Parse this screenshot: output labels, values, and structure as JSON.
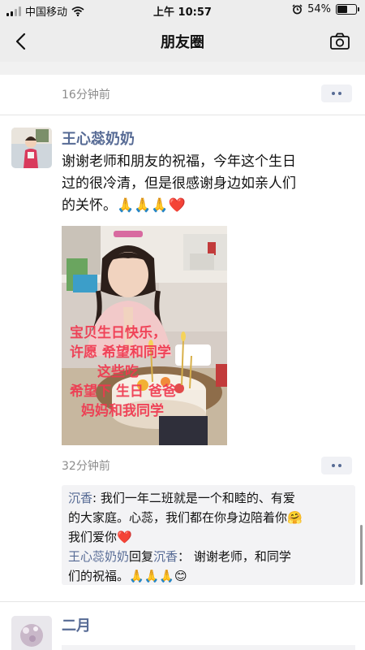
{
  "status_bar": {
    "carrier": "中国移动",
    "time": "上午 10:57",
    "battery_text": "54%",
    "battery_level": 0.54,
    "icons": [
      "signal-icon",
      "wifi-icon",
      "alarm-icon",
      "battery-icon"
    ]
  },
  "nav": {
    "title": "朋友圈",
    "back_icon": "chevron-left-icon",
    "camera_icon": "camera-icon"
  },
  "top_post": {
    "time": "16分钟前"
  },
  "post": {
    "author": "王心蕊奶奶",
    "text_lines": [
      "谢谢老师和朋友的祝福，今年这个生日",
      "过的很冷清，但是很感谢身边如亲人们",
      "的关怀。🙏🙏🙏❤️"
    ],
    "photo_caption": [
      "宝贝生日快乐，",
      "许愿 希望和同学",
      "这些吃",
      "希望下 生日 爸爸",
      "妈妈和我同学"
    ],
    "time": "32分钟前",
    "comments": [
      {
        "name": "沉香",
        "sep": ": ",
        "line1": "我们一年二班就是一个和睦的、有爱",
        "line2": "的大家庭。心蕊，我们都在你身边陪着你🤗",
        "line3": "我们爱你❤️"
      },
      {
        "name": "王心蕊奶奶",
        "reply_word": "回复",
        "reply_to": "沉香",
        "sep": "：",
        "line1": " 谢谢老师，和同学",
        "line2": "们的祝福。🙏🙏🙏😊"
      }
    ]
  },
  "next_post": {
    "author": "二月"
  },
  "colors": {
    "link_blue": "#576b95",
    "bar_grey": "#ededed",
    "comment_bg": "#f3f3f5",
    "heart_red": "#e8503a"
  }
}
